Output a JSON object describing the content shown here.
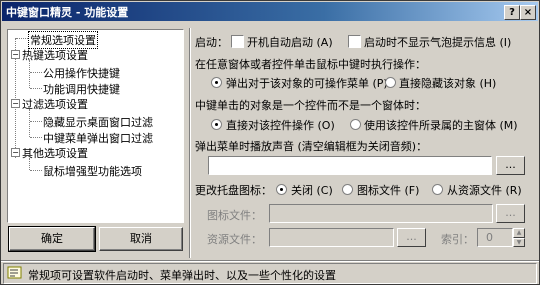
{
  "window": {
    "title": "中键窗口精灵 - 功能设置",
    "help_btn": "?",
    "close_btn": "×"
  },
  "tree": {
    "nodes": [
      {
        "label": "常规选项设置"
      },
      {
        "label": "热键选项设置"
      },
      {
        "label": "公用操作快捷键"
      },
      {
        "label": "功能调用快捷键"
      },
      {
        "label": "过滤选项设置"
      },
      {
        "label": "隐藏显示桌面窗口过滤"
      },
      {
        "label": "中键菜单弹出窗口过滤"
      },
      {
        "label": "其他选项设置"
      },
      {
        "label": "鼠标增强型功能选项"
      }
    ]
  },
  "buttons": {
    "ok": "确定",
    "cancel": "取消"
  },
  "startup": {
    "label": "启动：",
    "autostart": "开机自动启动 (A)",
    "no_balloon": "启动时不显示气泡提示信息 (I)"
  },
  "window_click": {
    "label": "在任意窗体或者控件单击鼠标中键时执行操作：",
    "option1": "弹出对于该对象的可操作菜单 (P)",
    "option2": "直接隐藏该对象 (H)"
  },
  "control_click": {
    "label": "中键单击的对象是一个控件而不是一个窗体时：",
    "option1": "直接对该控件操作 (O)",
    "option2": "使用该控件所录属的主窗体 (M)"
  },
  "sound": {
    "label": "弹出菜单时播放声音 (清空编辑框为关闭音频)：",
    "value": "",
    "browse": "..."
  },
  "tray": {
    "label": "更改托盘图标：",
    "opt_off": "关闭 (C)",
    "opt_icon": "图标文件 (F)",
    "opt_res": "从资源文件 (R)",
    "icon_file_label": "图标文件：",
    "icon_browse": "...",
    "res_file_label": "资源文件：",
    "res_browse": "...",
    "index_label": "索引：",
    "index_value": "0"
  },
  "status": {
    "text": "常规项可设置软件启动时、菜单弹出时、以及一些个性化的设置"
  }
}
